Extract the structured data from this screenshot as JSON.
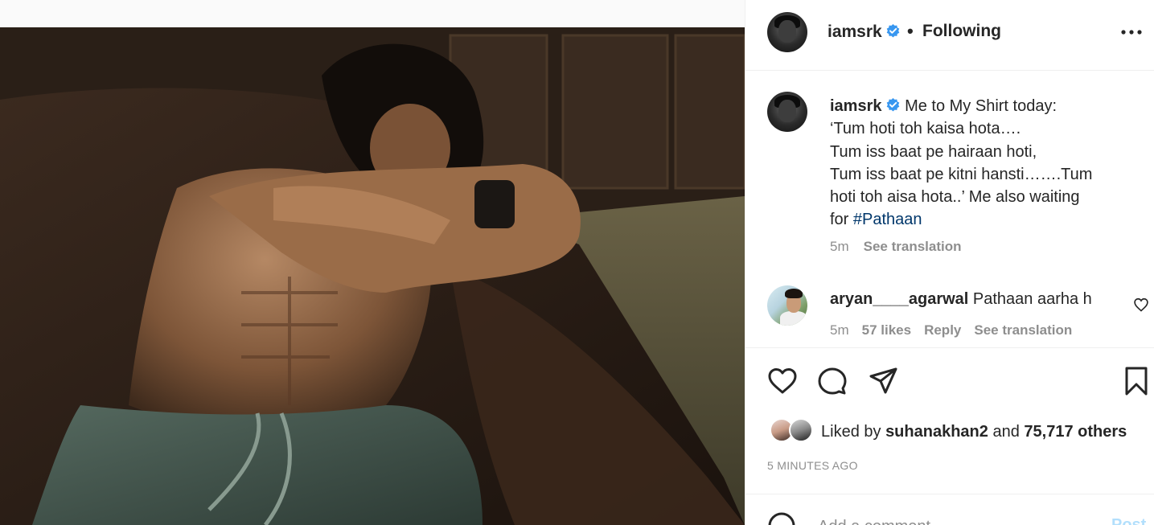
{
  "post": {
    "username": "iamsrk",
    "follow_status": "Following",
    "separator": "•",
    "more_icon": "more-options-icon"
  },
  "caption": {
    "username": "iamsrk",
    "lines": [
      "Me to My Shirt today:",
      "‘Tum hoti toh kaisa hota….",
      "Tum iss baat pe hairaan hoti,",
      "Tum iss baat pe kitni hansti…….Tum",
      "hoti toh aisa hota..’ Me also waiting",
      "for "
    ],
    "hashtag": "#Pathaan",
    "time": "5m",
    "see_translation": "See translation"
  },
  "comment": {
    "username": "aryan____agarwal",
    "text": "Pathaan aarha h",
    "time": "5m",
    "likes": "57 likes",
    "reply": "Reply",
    "see_translation": "See translation"
  },
  "likes": {
    "prefix": "Liked by",
    "user": "suhanakhan2",
    "and": "and",
    "others": "75,717 others"
  },
  "timestamp": "5 MINUTES AGO",
  "add_comment": {
    "placeholder": "Add a comment...",
    "post_label": "Post"
  },
  "colors": {
    "verified": "#3897f0",
    "link": "#00376b",
    "muted": "#8e8e8e",
    "post_disabled": "#b2dffc"
  }
}
